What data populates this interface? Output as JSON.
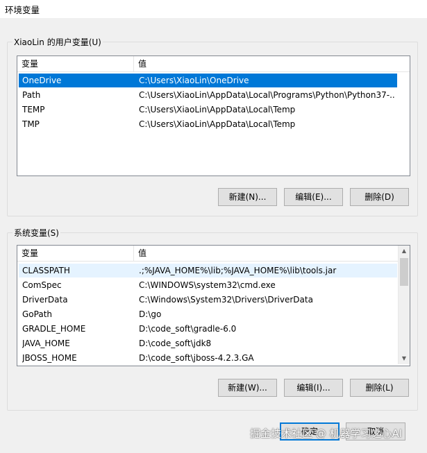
{
  "window": {
    "title": "环境变量"
  },
  "user_vars": {
    "group_label": "XiaoLin 的用户变量(U)",
    "columns": [
      "变量",
      "值"
    ],
    "rows": [
      {
        "name": "OneDrive",
        "value": "C:\\Users\\XiaoLin\\OneDrive"
      },
      {
        "name": "Path",
        "value": "C:\\Users\\XiaoLin\\AppData\\Local\\Programs\\Python\\Python37-..."
      },
      {
        "name": "TEMP",
        "value": "C:\\Users\\XiaoLin\\AppData\\Local\\Temp"
      },
      {
        "name": "TMP",
        "value": "C:\\Users\\XiaoLin\\AppData\\Local\\Temp"
      }
    ],
    "buttons": {
      "new": "新建(N)...",
      "edit": "编辑(E)...",
      "delete": "删除(D)"
    }
  },
  "system_vars": {
    "group_label": "系统变量(S)",
    "columns": [
      "变量",
      "值"
    ],
    "rows": [
      {
        "name": "CLASSPATH",
        "value": ".;%JAVA_HOME%\\lib;%JAVA_HOME%\\lib\\tools.jar"
      },
      {
        "name": "ComSpec",
        "value": "C:\\WINDOWS\\system32\\cmd.exe"
      },
      {
        "name": "DriverData",
        "value": "C:\\Windows\\System32\\Drivers\\DriverData"
      },
      {
        "name": "GoPath",
        "value": "D:\\go"
      },
      {
        "name": "GRADLE_HOME",
        "value": "D:\\code_soft\\gradle-6.0"
      },
      {
        "name": "JAVA_HOME",
        "value": "D:\\code_soft\\jdk8"
      },
      {
        "name": "JBOSS_HOME",
        "value": "D:\\code_soft\\jboss-4.2.3.GA"
      }
    ],
    "buttons": {
      "new": "新建(W)...",
      "edit": "编辑(I)...",
      "delete": "删除(L)"
    }
  },
  "footer": {
    "ok": "确定",
    "cancel": "取消"
  },
  "watermark": "掘金技术社区 @ 机器学习之心AI",
  "colors": {
    "selection": "#0078d7",
    "hover": "#e5f3ff",
    "default_border": "#0078d7"
  }
}
